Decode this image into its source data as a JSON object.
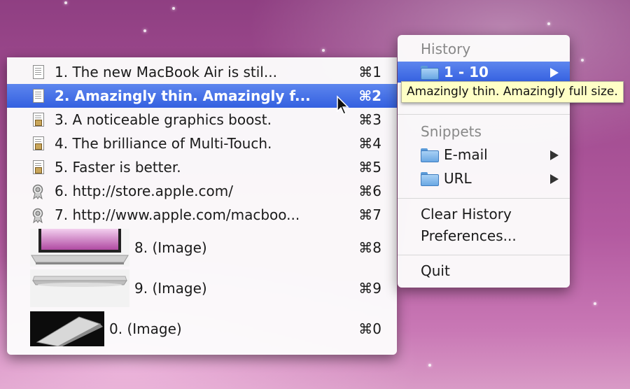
{
  "history_items": [
    {
      "label": "1. The new MacBook Air is stil...",
      "shortcut": "⌘1",
      "icon": "document-icon"
    },
    {
      "label": "2. Amazingly thin. Amazingly f...",
      "shortcut": "⌘2",
      "icon": "document-icon",
      "selected": true
    },
    {
      "label": "3. A noticeable graphics boost.",
      "shortcut": "⌘3",
      "icon": "rich-document-icon"
    },
    {
      "label": "4. The brilliance of Multi-Touch.",
      "shortcut": "⌘4",
      "icon": "rich-document-icon"
    },
    {
      "label": "5. Faster is better.",
      "shortcut": "⌘5",
      "icon": "rich-document-icon"
    },
    {
      "label": "6. http://store.apple.com/",
      "shortcut": "⌘6",
      "icon": "url-icon"
    },
    {
      "label": "7. http://www.apple.com/macboo...",
      "shortcut": "⌘7",
      "icon": "url-icon"
    }
  ],
  "image_items": [
    {
      "label": "8. (Image)",
      "shortcut": "⌘8",
      "icon": "image-thumbnail"
    },
    {
      "label": "9. (Image)",
      "shortcut": "⌘9",
      "icon": "image-thumbnail"
    },
    {
      "label": "0. (Image)",
      "shortcut": "⌘0",
      "icon": "image-thumbnail"
    }
  ],
  "submenu": {
    "history_header": "History",
    "history_range": "1 - 10",
    "snippets_header": "Snippets",
    "email_label": "E-mail",
    "url_label": "URL",
    "clear_history": "Clear History",
    "preferences": "Preferences...",
    "quit": "Quit"
  },
  "tooltip": "Amazingly thin. Amazingly full size.",
  "colors": {
    "selection": "#3a66e4",
    "tooltip_bg": "#ffffc6"
  }
}
